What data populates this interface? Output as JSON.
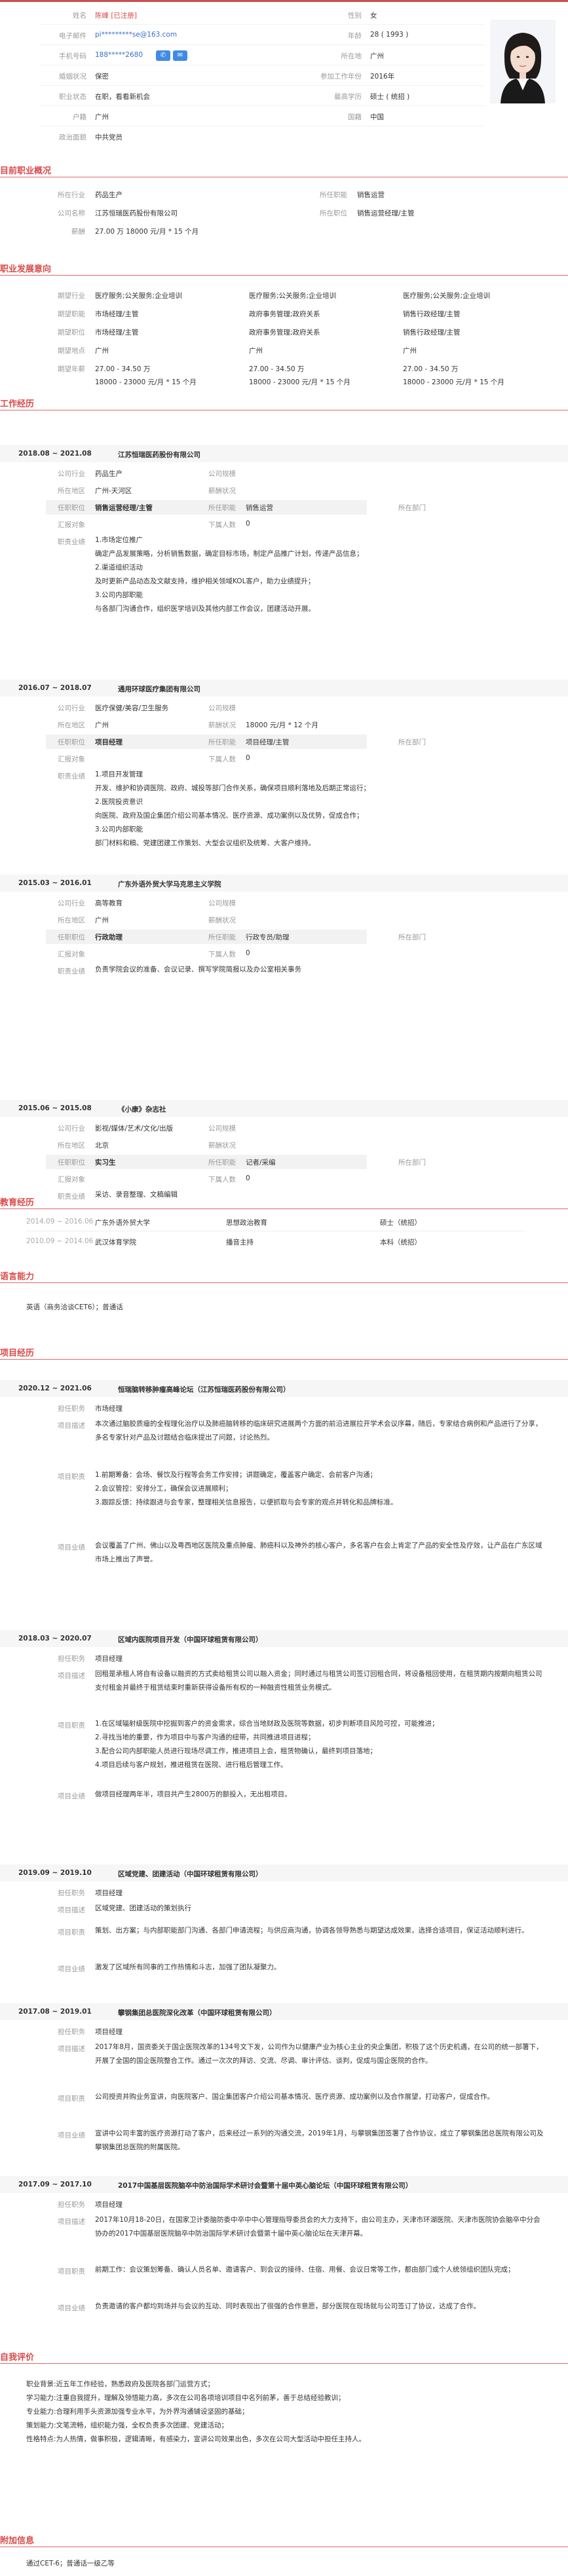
{
  "basic": {
    "rows": [
      {
        "l1": "姓名",
        "v1": "陈峰 [已注册]",
        "l2": "性别",
        "v2": "女"
      },
      {
        "l1": "电子邮件",
        "v1": "pi*********se@163.com",
        "l2": "年龄",
        "v2": "28 ( 1993 )"
      },
      {
        "l1": "手机号码",
        "v1": "188*****2680",
        "l2": "所在地",
        "v2": "广州"
      },
      {
        "l1": "婚姻状况",
        "v1": "保密",
        "l2": "参加工作年份",
        "v2": "2016年"
      },
      {
        "l1": "职业状态",
        "v1": "在职，看看新机会",
        "l2": "最高学历",
        "v2": "硕士 ( 统招 )"
      },
      {
        "l1": "户籍",
        "v1": "广州",
        "l2": "国籍",
        "v2": "中国"
      },
      {
        "l1": "政治面貌",
        "v1": "中共党员",
        "l2": "",
        "v2": ""
      }
    ],
    "phone_icon": "phone-icon",
    "sms_icon": "sms-icon",
    "avatar_icon": "avatar-photo"
  },
  "sections": {
    "current_job": "目前职业概况",
    "intention": "职业发展意向",
    "work": "工作经历",
    "education": "教育经历",
    "language": "语言能力",
    "project": "项目经历",
    "self_eval": "自我评价",
    "additional": "附加信息"
  },
  "current_job": {
    "labels": [
      "所在行业",
      "公司名称",
      "薪酬",
      "所任职能",
      "所在职位"
    ],
    "industry": "药品生产",
    "company": "江苏恒瑞医药股份有限公司",
    "salary": "27.00 万 18000 元/月 * 15 个月",
    "function": "销售运营",
    "position": "销售运营经理/主管"
  },
  "intention": {
    "labels": [
      "期望行业",
      "期望职能",
      "期望职位",
      "期望地点",
      "期望年薪"
    ],
    "cols": [
      {
        "industry": "医疗服务;公关服务;企业培训",
        "function": "市场经理/主管",
        "position": "市场经理/主管",
        "location": "广州",
        "salary1": "27.00 - 34.50 万",
        "salary2": "18000 - 23000 元/月 * 15 个月"
      },
      {
        "industry": "医疗服务;公关服务;企业培训",
        "function": "政府事务管理;政府关系",
        "position": "政府事务管理;政府关系",
        "location": "广州",
        "salary1": "27.00 - 34.50 万",
        "salary2": "18000 - 23000 元/月 * 15 个月"
      },
      {
        "industry": "医疗服务;公关服务;企业培训",
        "function": "销售行政经理/主管",
        "position": "销售行政经理/主管",
        "location": "广州",
        "salary1": "27.00 - 34.50 万",
        "salary2": "18000 - 23000 元/月 * 15 个月"
      }
    ]
  },
  "work": [
    {
      "period": "2018.08 ~ 2021.08",
      "company": "江苏恒瑞医药股份有限公司",
      "rows": [
        {
          "l1": "公司行业",
          "v1": "药品生产",
          "l2": "公司规模",
          "v2": ""
        },
        {
          "l1": "所在地区",
          "v1": "广州-天河区",
          "l2": "薪酬状况",
          "v2": ""
        },
        {
          "l1": "任职职位",
          "v1": "销售运营经理/主管",
          "l2": "所任职能",
          "v2": "销售运营",
          "l3": "所在部门",
          "v3": ""
        },
        {
          "l1": "汇报对象",
          "v1": "",
          "l2": "下属人数",
          "v2": "0"
        }
      ],
      "desc_label": "职责业绩",
      "desc": "1.市场定位推广\n确定产品发展策略，分析销售数据，确定目标市场，制定产品推广计划，传递产品信息；\n2.渠道组织活动\n及时更新产品动态及文献支持，维护相关领域KOL客户，助力业绩提升；\n3.公司内部职能\n与各部门沟通合作，组织医学培训及其他内部工作会议，团建活动开展。"
    },
    {
      "period": "2016.07 ~ 2018.07",
      "company": "通用环球医疗集团有限公司",
      "rows": [
        {
          "l1": "公司行业",
          "v1": "医疗保健/美容/卫生服务",
          "l2": "公司规模",
          "v2": ""
        },
        {
          "l1": "所在地区",
          "v1": "广州",
          "l2": "薪酬状况",
          "v2": "18000 元/月 * 12 个月"
        },
        {
          "l1": "任职职位",
          "v1": "项目经理",
          "l2": "所任职能",
          "v2": "项目经理/主管",
          "l3": "所在部门",
          "v3": ""
        },
        {
          "l1": "汇报对象",
          "v1": "",
          "l2": "下属人数",
          "v2": "0"
        }
      ],
      "desc_label": "职责业绩",
      "desc": "1.项目开发管理\n开发、维护和协调医院、政府、城投等部门合作关系，确保项目顺利落地及后期正常运行；\n2.医院投资意识\n向医院、政府及国企集团介绍公司基本情况、医疗资源、成功案例以及优势，促成合作；\n3.公司内部职能\n部门材料和稿、党建团建工作策划、大型会议组织及统筹、大客户维持。"
    },
    {
      "period": "2015.03 ~ 2016.01",
      "company": "广东外语外贸大学马克思主义学院",
      "rows": [
        {
          "l1": "公司行业",
          "v1": "高等教育",
          "l2": "公司规模",
          "v2": ""
        },
        {
          "l1": "所在地区",
          "v1": "广州",
          "l2": "薪酬状况",
          "v2": ""
        },
        {
          "l1": "任职职位",
          "v1": "行政助理",
          "l2": "所任职能",
          "v2": "行政专员/助理",
          "l3": "所在部门",
          "v3": ""
        },
        {
          "l1": "汇报对象",
          "v1": "",
          "l2": "下属人数",
          "v2": "0"
        }
      ],
      "desc_label": "职责业绩",
      "desc": "负责学院会议的准备、会议记录、撰写学院简报以及办公室相关事务"
    },
    {
      "period": "2015.06 ~ 2015.08",
      "company": "《小康》杂志社",
      "rows": [
        {
          "l1": "公司行业",
          "v1": "影视/媒体/艺术/文化/出版",
          "l2": "公司规模",
          "v2": ""
        },
        {
          "l1": "所在地区",
          "v1": "北京",
          "l2": "薪酬状况",
          "v2": ""
        },
        {
          "l1": "任职职位",
          "v1": "实习生",
          "l2": "所任职能",
          "v2": "记者/采编",
          "l3": "所在部门",
          "v3": ""
        },
        {
          "l1": "汇报对象",
          "v1": "",
          "l2": "下属人数",
          "v2": "0"
        }
      ],
      "desc_label": "职责业绩",
      "desc": "采访、录音整理、文稿编辑"
    }
  ],
  "education": [
    {
      "period": "2014.09 ~ 2016.06",
      "school": "广东外语外贸大学",
      "major": "思想政治教育",
      "degree": "硕士（统招）"
    },
    {
      "period": "2010.09 ~ 2014.06",
      "school": "武汉体育学院",
      "major": "播音主持",
      "degree": "本科（统招）"
    }
  ],
  "language": {
    "text": "英语（商务洽谈CET6）；普通话"
  },
  "projects": [
    {
      "period": "2020.12 ~ 2021.06",
      "name": "恒瑞脑转移肿瘤高峰论坛（江苏恒瑞医药股份有限公司）",
      "role_label": "担任职务",
      "role": "市场经理",
      "desc_label": "项目描述",
      "desc": "本次通过脑胶质瘤的全程理化治疗以及肺癌脑转移的临床研究进展两个方面的前沿进展拉开学术会议序幕，随后，专家结合病例和产品进行了分享，多名专家针对产品及讨题结合临床提出了问题，讨论热烈。",
      "duty_label": "项目职责",
      "duty": "1.前期筹备：会场、餐饮及行程等会务工作安排；讲题确定，覆盖客户确定、会前客户沟通；\n2.会议管控：安排分工，确保会议进展顺利；\n3.跟踪反馈：持续跟进与会专家，整理相关信息报告，以便抓取与会专家的观点并转化和品牌标准。",
      "result_label": "项目业绩",
      "result": "会议覆盖了广州、佛山以及粤西地区医院及重点肿瘤、肺癌科以及神外的核心客户，多名客户在会上肯定了产品的安全性及疗效，让产品在广东区域市场上推出了声誉。"
    },
    {
      "period": "2018.03 ~ 2020.07",
      "name": "区域内医院项目开发（中国环球租赁有限公司）",
      "role_label": "担任职务",
      "role": "项目经理",
      "desc_label": "项目描述",
      "desc": "回租是承租人将自有设备以融资的方式卖给租赁公司以融入资金；同时通过与租赁公司签订回租合同，将设备租回使用，在租赁期内按期向租赁公司支付租金并最终于租赁结束时重新获得设备所有权的一种融资性租赁业务模式。",
      "duty_label": "项目职责",
      "duty": "1.在区域辐射级医院中挖掘到客户的资金需求，综合当地财政及医院等数据，初步判断项目风险可控，可能推进；\n2.寻找当地的重要，作为项目中与客户沟通的纽带，共同推进项目进程；\n3.配合公司内部职能人员进行现场尽调工作，推进项目上会，租赁物确认，最终到项目落地；\n4.项目后续与客户规划，推进租赁在医院、进行租后管理工作。",
      "result_label": "项目业绩",
      "result": "做项目经理两年半，项目共产生2800万的额投入，无出租项目。"
    },
    {
      "period": "2019.09 ~ 2019.10",
      "name": "区域党建、团建活动（中国环球租赁有限公司）",
      "role_label": "担任职务",
      "role": "项目经理",
      "desc_label": "项目描述",
      "desc": "区域党建、团建活动的策划执行",
      "duty_label": "项目职责",
      "duty": "策划、出方案；与内部职能部门沟通、各部门申请流程；与供应商沟通，协调各领导熟悉与期望达成效果，选择合适项目，保证活动顺利进行。",
      "result_label": "项目业绩",
      "result": "激发了区域所有同事的工作热情和斗志，加强了团队凝聚力。"
    },
    {
      "period": "2017.08 ~ 2019.01",
      "name": "攀钢集团总医院深化改革（中国环球租赁有限公司）",
      "role_label": "担任职务",
      "role": "项目经理",
      "desc_label": "项目描述",
      "desc": "2017年8月，国资委关于国企医院改革的134号文下发，公司作为以健康产业为核心主业的央企集团，积极了这个历史机遇，在公司的统一部署下，开展了全国的国企医院整合工作。通过一次次的拜访、交流、尽调、审计评估、谈判，促成与国企医院的合作。",
      "duty_label": "项目职责",
      "duty": "公司授资并购业务宣讲，向医院客户、国企集团客户介绍公司基本情况、医疗资源、成功案例以及合作展望，打动客户，促成合作。",
      "result_label": "项目业绩",
      "result": "宣讲中公司丰富的医疗资源打动了客户，后来经过一系列的沟通交流，2019年1月，与攀钢集团签署了合作协议，成立了攀钢集团总医院有限公司及攀钢集团总医院的附属医院。"
    },
    {
      "period": "2017.09 ~ 2017.10",
      "name": "2017中国基层医院脑卒中防治国际学术研讨会暨第十届中英心脑论坛（中国环球租赁有限公司）",
      "role_label": "担任职务",
      "role": "项目经理",
      "desc_label": "项目描述",
      "desc": "2017年10月18-20日，在国家卫计委脑防委中卒中中心管理指导委员会的大力支持下，由公司主办，天津市环湖医院、天津市医院协会脑卒中分会协办的2017中国基层医院脑卒中防治国际学术研讨会暨第十届中英心脑论坛在天津开幕。",
      "duty_label": "项目职责",
      "duty": "前期工作：会议策划筹备、确认人员名单、邀请客户、到会议的接待、住宿、用餐、会议日常等工作，都由部门或个人统领组织团队完成；",
      "result_label": "项目业绩",
      "result": "负责邀请的客户都均到场并与会议的互动、同时表现出了很强的合作意愿，部分医院在现场就与公司签订了协议，达成了合作。"
    }
  ],
  "self_eval": {
    "text": "职业背景:近五年工作经验，熟悉政府及医院各部门运营方式；\n学习能力:注重自我提升，理解及领悟能力高，多次在公司各项培训项目中名列前茅，善于总结经验教训；\n专业能力:合理利用手头资源加强专业水平，为外界沟通铺设坚固的基础；\n策划能力:文笔流畅，组织能力强，全权负责多次团建、党建活动；\n性格特点:为人热情，做事积极，逻辑清晰，有感染力，宣讲公司效果出色，多次在公司大型活动中担任主持人。"
  },
  "additional": {
    "text": "通过CET-6；普通话一级乙等"
  }
}
